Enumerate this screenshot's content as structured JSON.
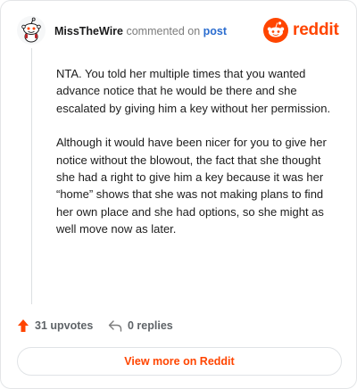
{
  "header": {
    "username": "MissTheWire",
    "action": "commented on",
    "post_link": "post",
    "brand": "reddit"
  },
  "comment": {
    "paragraphs": [
      "NTA. You told her multiple times that you wanted advance notice that he would be there and she escalated by giving him a key without her permission.",
      "Although it would have been nicer for you to give her notice without the blowout, the fact that she thought she had a right to give him a key because it was her “home” shows that she was not making plans to find her own place and she had options, so she might as well move now as later."
    ]
  },
  "stats": {
    "upvotes_label": "31 upvotes",
    "replies_label": "0 replies"
  },
  "footer": {
    "view_more_label": "View more on Reddit"
  },
  "colors": {
    "brand": "#ff4500",
    "link": "#2a6ccf",
    "muted": "#7c7c7c"
  },
  "icons": {
    "avatar": "snoo-avatar",
    "brand": "reddit-logo",
    "upvote": "upvote-arrow-icon",
    "reply": "reply-arrow-icon"
  }
}
